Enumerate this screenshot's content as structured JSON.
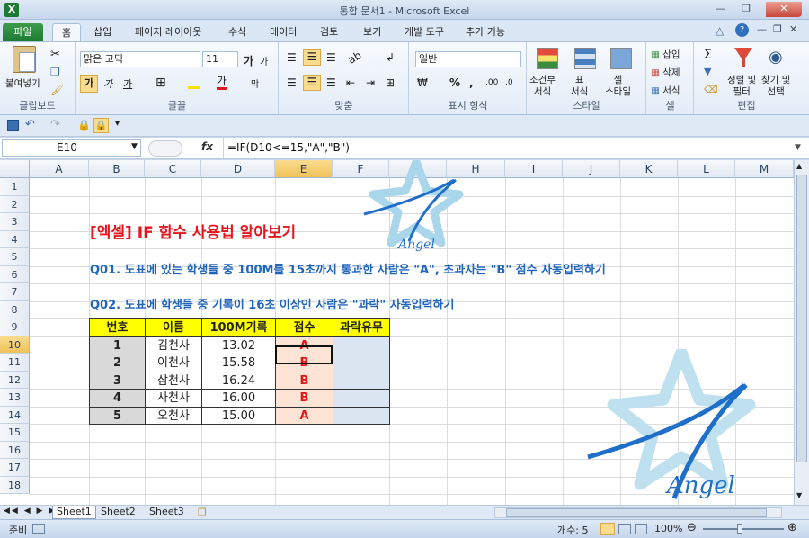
{
  "window": {
    "title": "통합 문서1  -  Microsoft Excel"
  },
  "tabs": [
    "파일",
    "홈",
    "삽입",
    "페이지 레이아웃",
    "수식",
    "데이터",
    "검토",
    "보기",
    "개발 도구",
    "추가 기능"
  ],
  "ribbon": {
    "clipboard": {
      "paste": "붙여넣기",
      "group": "클립보드"
    },
    "font": {
      "name": "맑은 고딕",
      "size": "11",
      "bold": "가",
      "italic": "가",
      "underline": "가",
      "group": "글꼴",
      "grow": "가",
      "shrink": "가"
    },
    "align": {
      "group": "맞춤"
    },
    "number": {
      "format": "일반",
      "group": "표시 형식",
      "percent": "%",
      "comma": ","
    },
    "style": {
      "cond": "조건부\n서식",
      "table": "표\n서식",
      "cell": "셀\n스타일",
      "group": "스타일"
    },
    "cells": {
      "insert": "삽입",
      "delete": "삭제",
      "format": "서식",
      "group": "셀"
    },
    "edit": {
      "sort": "정렬 및\n필터",
      "find": "찾기 및\n선택",
      "group": "편집"
    }
  },
  "formula_bar": {
    "name_box": "E10",
    "fx": "fx",
    "formula": "=IF(D10<=15,\"A\",\"B\")"
  },
  "columns": [
    "A",
    "B",
    "C",
    "D",
    "E",
    "F",
    "G",
    "H",
    "I",
    "J",
    "K",
    "L",
    "M"
  ],
  "rows": [
    "1",
    "2",
    "3",
    "4",
    "5",
    "6",
    "7",
    "8",
    "9",
    "10",
    "11",
    "12",
    "13",
    "14",
    "15",
    "16",
    "17",
    "18"
  ],
  "sheet": {
    "title": "[엑셀] IF 함수 사용법 알아보기",
    "q1": "Q01. 도표에 있는 학생들 중 100M를 15초까지 통과한 사람은 \"A\", 초과자는 \"B\" 점수 자동입력하기",
    "q2": "Q02. 도표에 학생들 중 기록이 16초 이상인 사람은 \"과락\" 자동입력하기",
    "table": {
      "headers": [
        "번호",
        "이름",
        "100M기록",
        "점수",
        "과락유무"
      ],
      "rows": [
        [
          "1",
          "김천사",
          "13.02",
          "A",
          ""
        ],
        [
          "2",
          "이천사",
          "15.58",
          "B",
          ""
        ],
        [
          "3",
          "삼천사",
          "16.24",
          "B",
          ""
        ],
        [
          "4",
          "사천사",
          "16.00",
          "B",
          ""
        ],
        [
          "5",
          "오천사",
          "15.00",
          "A",
          ""
        ]
      ]
    },
    "watermark": "Angel"
  },
  "sheet_tabs": [
    "Sheet1",
    "Sheet2",
    "Sheet3"
  ],
  "status": {
    "ready": "준비",
    "count": "개수: 5",
    "zoom": "100%"
  }
}
